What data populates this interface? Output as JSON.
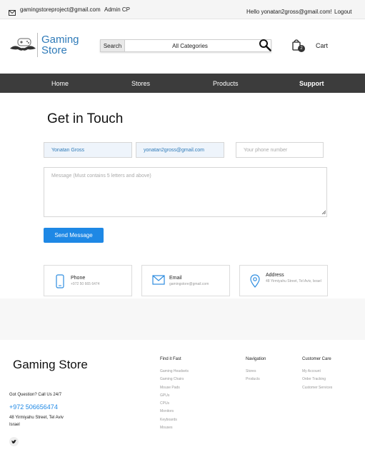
{
  "topbar": {
    "contact_email": "gamingstoreproject@gmail.com",
    "admin_link": "Admin CP",
    "greeting": "Hello yonatan2gross@gmail.com!",
    "logout": "Logout"
  },
  "header": {
    "logo_line1": "Gaming",
    "logo_line2": "Store",
    "search_button": "Search",
    "category_select": "All Categories",
    "cart_count": "2",
    "cart_label": "Cart"
  },
  "nav": {
    "items": [
      "Home",
      "Stores",
      "Products",
      "Support"
    ],
    "active": "Support"
  },
  "form": {
    "title": "Get in Touch",
    "name_value": "Yonatan Gross",
    "email_value": "yonatan2gross@gmail.com",
    "phone_placeholder": "Your phone number",
    "message_placeholder": "Message (Must contains 5 letters and above)",
    "send_button": "Send Message"
  },
  "contact_cards": [
    {
      "icon": "phone-icon",
      "title": "Phone",
      "value": "+972 50 665 6474"
    },
    {
      "icon": "mail-icon",
      "title": "Email",
      "value": "gamingstore@gmail.com"
    },
    {
      "icon": "location-pin-icon",
      "title": "Address",
      "value": "48 Yirmiyahu Street, Tel Aviv, Israel"
    }
  ],
  "footer": {
    "brand": "Gaming Store",
    "question": "Got Question? Call Us 24/7",
    "phone": "+972 506656474",
    "address_line1": "48 Yirmiyahu Street, Tel Aviv",
    "address_line2": "Israel",
    "find_it_fast": {
      "heading": "Find it Fast",
      "links": [
        "Gaming Headsets",
        "Gaming Chairs",
        "Mouse Pads",
        "GPUs",
        "CPUs",
        "Monitors",
        "Keyboards",
        "Mouses"
      ]
    },
    "navigation": {
      "heading": "Navigation",
      "links": [
        "Stores",
        "Products"
      ]
    },
    "customer_care": {
      "heading": "Customer Care",
      "links": [
        "My Account",
        "Order Tracking",
        "Customer Services"
      ]
    }
  },
  "colors": {
    "accent": "#1e88e5",
    "brand": "#2e7ab8",
    "nav_bg": "#3c3c3c"
  }
}
